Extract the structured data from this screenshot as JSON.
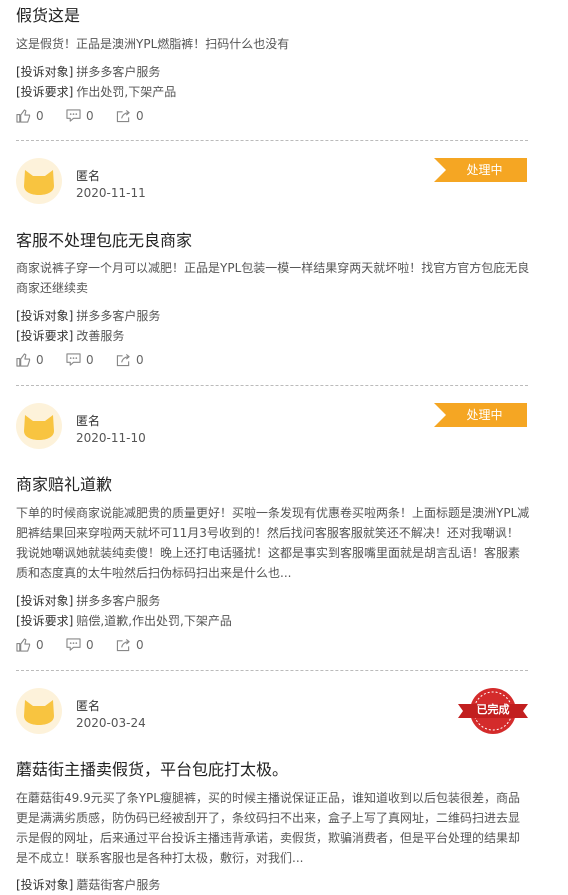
{
  "posts": [
    {
      "title": "假货这是",
      "body": "这是假货！正品是澳洲YPL燃脂裤！扫码什么也没有",
      "target_label": "[投诉对象]",
      "target": "拼多多客户服务",
      "demand_label": "[投诉要求]",
      "demand": "作出处罚,下架产品",
      "likes": "0",
      "comments": "0",
      "shares": "0"
    },
    {
      "user": "匿名",
      "date": "2020-11-11",
      "status": "处理中",
      "title": "客服不处理包庇无良商家",
      "body": "商家说裤子穿一个月可以减肥！正品是YPL包装一模一样结果穿两天就坏啦！找官方官方包庇无良商家还继续卖",
      "target_label": "[投诉对象]",
      "target": "拼多多客户服务",
      "demand_label": "[投诉要求]",
      "demand": "改善服务",
      "likes": "0",
      "comments": "0",
      "shares": "0"
    },
    {
      "user": "匿名",
      "date": "2020-11-10",
      "status": "处理中",
      "title": "商家赔礼道歉",
      "body": "下单的时候商家说能减肥贵的质量更好！买啦一条发现有优惠卷买啦两条！上面标题是澳洲YPL减肥裤结果回来穿啦两天就坏可11月3号收到的！然后找问客服客服就笑还不解决！还对我嘲讽！我说她嘲讽她就装纯卖傻！晚上还打电话骚扰！这都是事实到客服嘴里面就是胡言乱语！客服素质和态度真的太牛啦然后扫伪标码扫出来是什么也...",
      "target_label": "[投诉对象]",
      "target": "拼多多客户服务",
      "demand_label": "[投诉要求]",
      "demand": "赔偿,道歉,作出处罚,下架产品",
      "likes": "0",
      "comments": "0",
      "shares": "0"
    },
    {
      "user": "匿名",
      "date": "2020-03-24",
      "status": "已完成",
      "title": "蘑菇街主播卖假货，平台包庇打太极。",
      "body": "在蘑菇街49.9元买了条YPL瘦腿裤，买的时候主播说保证正品，谁知道收到以后包装很差，商品更是满满劣质感，防伪码已经被刮开了，条纹码扫不出来，盒子上写了真网址，二维码扫进去显示是假的网址，后来通过平台投诉主播违背承诺，卖假货，欺骗消费者，但是平台处理的结果却是不成立！联系客服也是各种打太极，敷衍，对我们...",
      "target_label": "[投诉对象]",
      "target": "蘑菇街客户服务"
    }
  ],
  "colors": {
    "ribbon": "#f5a623",
    "stamp": "#d42b2b",
    "avatar_bg": "#fdf2da",
    "cat": "#f8c440"
  }
}
